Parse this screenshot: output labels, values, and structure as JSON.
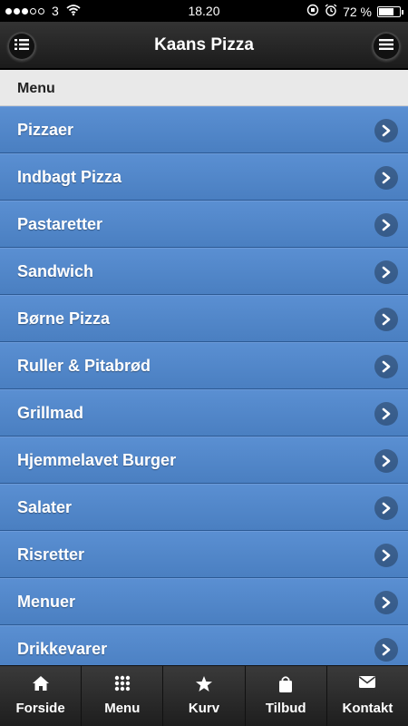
{
  "status_bar": {
    "carrier": "3",
    "time": "18.20",
    "battery": "72 %",
    "battery_level": 0.72
  },
  "header": {
    "title": "Kaans Pizza"
  },
  "section": {
    "label": "Menu"
  },
  "menu": {
    "items": [
      {
        "label": "Pizzaer"
      },
      {
        "label": "Indbagt Pizza"
      },
      {
        "label": "Pastaretter"
      },
      {
        "label": "Sandwich"
      },
      {
        "label": "Børne Pizza"
      },
      {
        "label": "Ruller & Pitabrød"
      },
      {
        "label": "Grillmad"
      },
      {
        "label": "Hjemmelavet Burger"
      },
      {
        "label": "Salater"
      },
      {
        "label": "Risretter"
      },
      {
        "label": "Menuer"
      },
      {
        "label": "Drikkevarer"
      }
    ]
  },
  "tabbar": {
    "tabs": [
      {
        "label": "Forside",
        "icon": "home-icon"
      },
      {
        "label": "Menu",
        "icon": "grid-icon"
      },
      {
        "label": "Kurv",
        "icon": "star-icon"
      },
      {
        "label": "Tilbud",
        "icon": "bag-icon"
      },
      {
        "label": "Kontakt",
        "icon": "envelope-icon"
      }
    ]
  },
  "colors": {
    "list_bg": "#4a7fc1",
    "header_bg": "#222222",
    "section_bg": "#e9e9e9"
  }
}
